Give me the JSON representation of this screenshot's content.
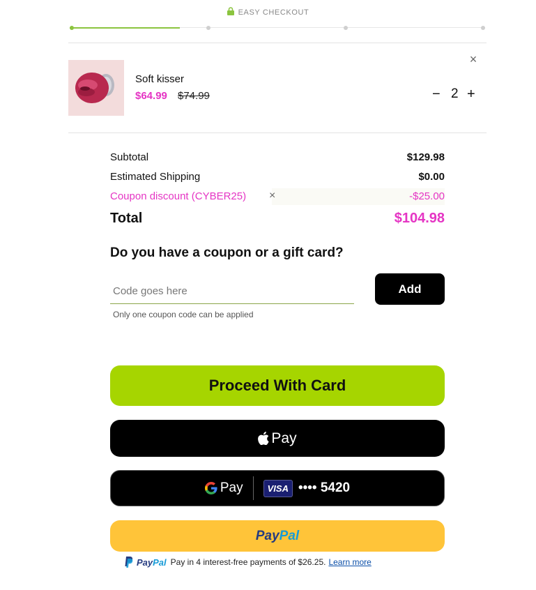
{
  "header": {
    "title": "EASY CHECKOUT",
    "lock_icon": "lock-icon"
  },
  "progress": {
    "steps": 4,
    "active_step": 1
  },
  "cart": {
    "item": {
      "name": "Soft kisser",
      "price": "$64.99",
      "original_price": "$74.99",
      "quantity": "2",
      "minus_label": "−",
      "plus_label": "+",
      "remove_label": "×"
    }
  },
  "summary": {
    "subtotal_label": "Subtotal",
    "subtotal_value": "$129.98",
    "shipping_label": "Estimated Shipping",
    "shipping_value": "$0.00",
    "coupon_label": "Coupon discount (CYBER25)",
    "coupon_remove": "×",
    "coupon_value": "-$25.00",
    "total_label": "Total",
    "total_value": "$104.98"
  },
  "coupon": {
    "title": "Do you have a coupon or a gift card?",
    "placeholder": "Code goes here",
    "add_label": "Add",
    "hint": "Only one coupon code can be applied"
  },
  "payments": {
    "card_label": "Proceed With Card",
    "apple_label": "Pay",
    "gpay_label": "G Pay",
    "visa_label": "VISA",
    "card_mask": "•••• 5420",
    "paypal_part1": "Pay",
    "paypal_part2": "Pal",
    "paylater_text": "Pay in 4 interest-free payments of $26.25.",
    "paylater_link": "Learn more"
  },
  "colors": {
    "accent_green": "#a6d500",
    "price_pink": "#e535c4",
    "paypal_yellow": "#ffc439"
  }
}
